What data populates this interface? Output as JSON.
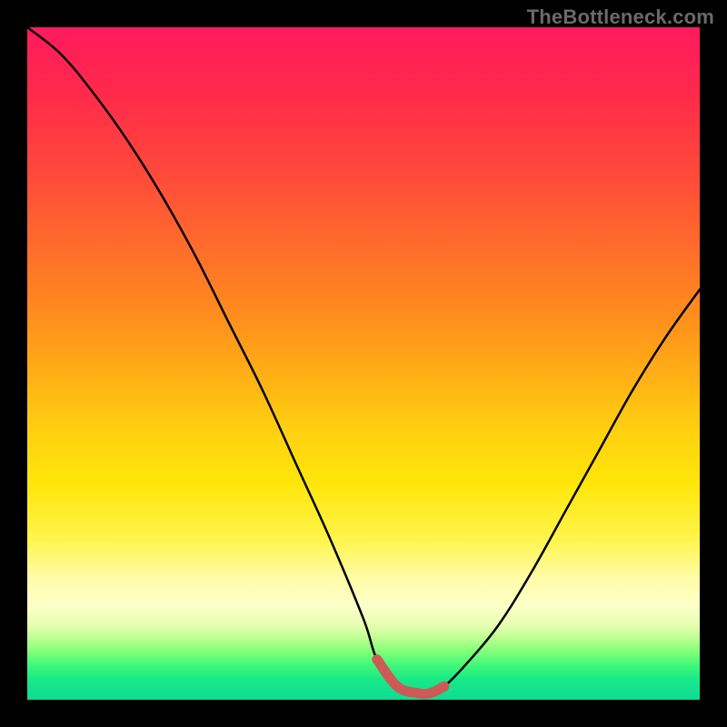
{
  "watermark": "TheBottleneck.com",
  "colors": {
    "frame": "#000000",
    "curve": "#000000",
    "trough_marker": "#cc5a57"
  },
  "chart_data": {
    "type": "line",
    "title": "",
    "xlabel": "",
    "ylabel": "",
    "xlim": [
      0,
      100
    ],
    "ylim": [
      0,
      100
    ],
    "grid": false,
    "legend": false,
    "annotations": [],
    "series": [
      {
        "name": "bottleneck-curve",
        "x": [
          0,
          5,
          10,
          15,
          20,
          25,
          30,
          35,
          40,
          45,
          50,
          52,
          55,
          58,
          60,
          62,
          65,
          70,
          75,
          80,
          85,
          90,
          95,
          100
        ],
        "y": [
          100,
          96,
          90,
          83,
          75,
          66,
          56,
          46,
          35,
          24,
          12,
          6,
          2,
          1,
          1,
          2,
          5,
          11,
          19,
          28,
          37,
          46,
          54,
          61
        ]
      },
      {
        "name": "trough-highlight",
        "x": [
          52,
          55,
          58,
          60,
          62
        ],
        "y": [
          6,
          2,
          1,
          1,
          2
        ]
      }
    ]
  }
}
